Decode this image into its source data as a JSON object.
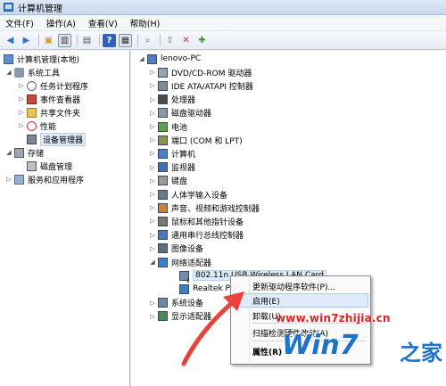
{
  "window": {
    "title": "计算机管理"
  },
  "menu": [
    "文件(F)",
    "操作(A)",
    "查看(V)",
    "帮助(H)"
  ],
  "left_tree": [
    {
      "label": "计算机管理(本地)",
      "exp": "",
      "icon": "computer-management-icon"
    },
    {
      "label": "系统工具",
      "exp": "◢",
      "icon": "tools-icon"
    },
    {
      "label": "任务计划程序",
      "exp": "▷",
      "icon": "clock-icon"
    },
    {
      "label": "事件查看器",
      "exp": "▷",
      "icon": "event-viewer-icon"
    },
    {
      "label": "共享文件夹",
      "exp": "▷",
      "icon": "shared-folder-icon"
    },
    {
      "label": "性能",
      "exp": "▷",
      "icon": "performance-icon"
    },
    {
      "label": "设备管理器",
      "exp": "",
      "icon": "device-manager-icon"
    },
    {
      "label": "存储",
      "exp": "◢",
      "icon": "storage-icon"
    },
    {
      "label": "磁盘管理",
      "exp": "",
      "icon": "disk-icon"
    },
    {
      "label": "服务和应用程序",
      "exp": "▷",
      "icon": "services-icon"
    }
  ],
  "right_tree": [
    {
      "label": "lenovo-PC",
      "exp": "◢",
      "icon": "computer-icon"
    },
    {
      "label": "DVD/CD-ROM 驱动器",
      "exp": "▷",
      "icon": "dvd-icon"
    },
    {
      "label": "IDE ATA/ATAPI 控制器",
      "exp": "▷",
      "icon": "ide-icon"
    },
    {
      "label": "处理器",
      "exp": "▷",
      "icon": "processor-icon"
    },
    {
      "label": "磁盘驱动器",
      "exp": "▷",
      "icon": "disk-drive-icon"
    },
    {
      "label": "电池",
      "exp": "▷",
      "icon": "battery-icon"
    },
    {
      "label": "端口 (COM 和 LPT)",
      "exp": "▷",
      "icon": "port-icon"
    },
    {
      "label": "计算机",
      "exp": "▷",
      "icon": "computer-icon"
    },
    {
      "label": "监视器",
      "exp": "▷",
      "icon": "monitor-icon"
    },
    {
      "label": "键盘",
      "exp": "▷",
      "icon": "keyboard-icon"
    },
    {
      "label": "人体学输入设备",
      "exp": "▷",
      "icon": "hid-icon"
    },
    {
      "label": "声音、视频和游戏控制器",
      "exp": "▷",
      "icon": "sound-icon"
    },
    {
      "label": "鼠标和其他指针设备",
      "exp": "▷",
      "icon": "mouse-icon"
    },
    {
      "label": "通用串行总线控制器",
      "exp": "▷",
      "icon": "usb-icon"
    },
    {
      "label": "图像设备",
      "exp": "▷",
      "icon": "camera-icon"
    },
    {
      "label": "网络适配器",
      "exp": "◢",
      "icon": "network-icon"
    },
    {
      "label": "802.11n USB Wireless LAN Card",
      "exp": "",
      "icon": "network-adapter-disabled-icon"
    },
    {
      "label": "Realtek PCI",
      "exp": "",
      "icon": "network-adapter-icon"
    },
    {
      "label": "系统设备",
      "exp": "▷",
      "icon": "system-device-icon"
    },
    {
      "label": "显示适配器",
      "exp": "▷",
      "icon": "display-adapter-icon"
    }
  ],
  "context_menu": {
    "items": [
      "更新驱动程序软件(P)...",
      "启用(E)",
      "卸载(U)",
      "扫描检测硬件改动(A)",
      "属性(R)"
    ]
  },
  "watermark": {
    "url": "www.win7zhijia.cn",
    "logo": "Win7",
    "home": "之家"
  },
  "colors": {
    "accent": "#3399ff",
    "watermark_red": "#d92727",
    "watermark_blue": "#1e73c8",
    "arrow": "#e8423b"
  }
}
